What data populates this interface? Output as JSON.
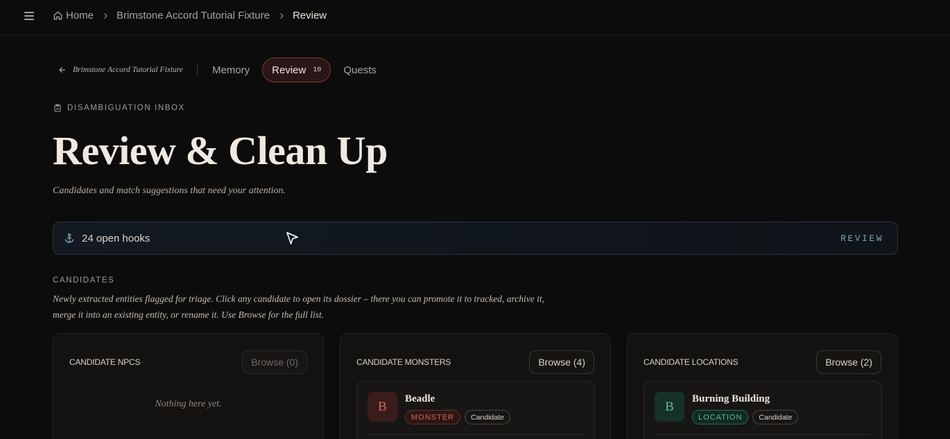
{
  "breadcrumb": {
    "items": [
      "Home",
      "Brimstone Accord Tutorial Fixture",
      "Review"
    ]
  },
  "subnav": {
    "back_label": "Brimstone Accord Tutorial Fixture",
    "tabs": [
      {
        "label": "Memory"
      },
      {
        "label": "Review",
        "count": "10",
        "active": true
      },
      {
        "label": "Quests"
      }
    ]
  },
  "header": {
    "eyebrow": "DISAMBIGUATION INBOX",
    "title": "Review & Clean Up",
    "subtitle": "Candidates and match suggestions that need your attention."
  },
  "hooks": {
    "text": "24 open hooks",
    "action": "REVIEW"
  },
  "candidates": {
    "label": "CANDIDATES",
    "description": "Newly extracted entities flagged for triage. Click any candidate to open its dossier – there you can promote it to tracked, archive it, merge it into an existing entity, or rename it. Use Browse for the full list.",
    "cards": [
      {
        "title": "CANDIDATE NPCS",
        "browse_label": "Browse (0)",
        "empty_text": "Nothing here yet."
      },
      {
        "title": "CANDIDATE MONSTERS",
        "browse_label": "Browse (4)",
        "entity": {
          "initial": "B",
          "name": "Beadle",
          "type": "MONSTER",
          "status": "Candidate"
        }
      },
      {
        "title": "CANDIDATE LOCATIONS",
        "browse_label": "Browse (2)",
        "entity": {
          "initial": "B",
          "name": "Burning Building",
          "type": "LOCATION",
          "status": "Candidate"
        }
      }
    ]
  },
  "colors": {
    "background": "#0d0c0c",
    "review_tab_bg": "#2b1517",
    "review_tab_border": "#7a3a3a",
    "monster_accent": "#d0675f",
    "location_accent": "#5cb99a",
    "hooks_action": "#7fa6b6"
  },
  "icons": [
    "menu-icon",
    "home-icon",
    "chevron-right-icon",
    "arrow-left-icon",
    "clipboard-check-icon",
    "anchor-icon",
    "cursor-icon"
  ]
}
